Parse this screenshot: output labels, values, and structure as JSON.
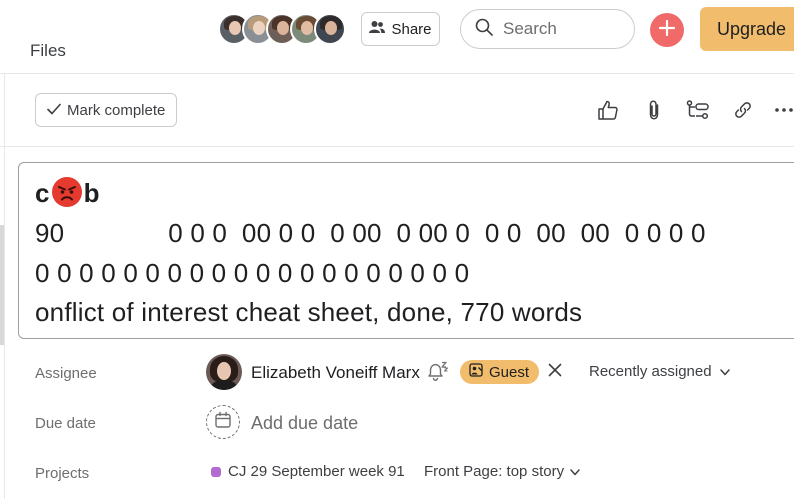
{
  "header": {
    "files_label": "Files",
    "share_label": "Share",
    "search_placeholder": "Search",
    "upgrade_label": "Upgrade",
    "collaborators": [
      {
        "hair": "#3a2f2a",
        "face": "#e8c8b2",
        "bg": "#5a5f66"
      },
      {
        "hair": "#b89b7a",
        "face": "#ecd2bf",
        "bg": "#8a8f96"
      },
      {
        "hair": "#4a3328",
        "face": "#dcb49a",
        "bg": "#6d5e57"
      },
      {
        "hair": "#6a4b35",
        "face": "#e2bca2",
        "bg": "#7c8a7a"
      },
      {
        "hair": "#2f2a2a",
        "face": "#d9b39a",
        "bg": "#3f4650"
      }
    ]
  },
  "toolbar": {
    "mark_complete_label": "Mark complete",
    "icons": [
      "thumbs-up-icon",
      "paperclip-icon",
      "subtask-icon",
      "link-icon",
      "more-icon"
    ]
  },
  "task": {
    "title_line1_prefix": "c",
    "title_line1_suffix": "b",
    "title_line2": "90              0 0 0  00 0 0  0 00  0 00 0  0 0  00  00  0 0 0 0",
    "title_line3": "0 0 0 0 0 0 0 0 0 0 0 0 0 0 0 0 0 0 0 0",
    "title_line4": "onflict of interest cheat sheet, done, 770 words"
  },
  "fields": {
    "assignee_label": "Assignee",
    "assignee_name": "Elizabeth Voneiff Marx",
    "guest_label": "Guest",
    "recently_assigned_label": "Recently assigned",
    "due_date_label": "Due date",
    "add_due_date_label": "Add due date",
    "projects_label": "Projects",
    "project_name": "CJ 29 September week 91",
    "project_section": "Front Page: top story",
    "project_color": "#b36bd4"
  }
}
